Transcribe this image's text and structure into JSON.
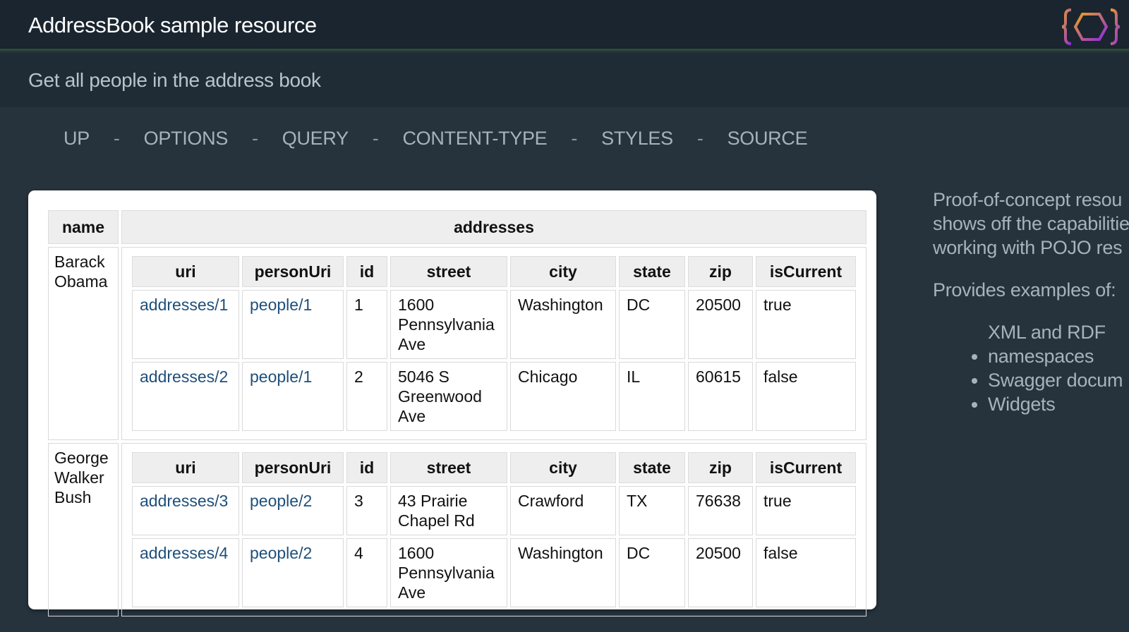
{
  "header": {
    "title": "AddressBook sample resource"
  },
  "subheader": {
    "text": "Get all people in the address book"
  },
  "nav": {
    "items": [
      "UP",
      "OPTIONS",
      "QUERY",
      "CONTENT-TYPE",
      "STYLES",
      "SOURCE"
    ],
    "separator": "-"
  },
  "table": {
    "headers": {
      "name": "name",
      "addresses": "addresses"
    },
    "inner_headers": [
      "uri",
      "personUri",
      "id",
      "street",
      "city",
      "state",
      "zip",
      "isCurrent"
    ],
    "people": [
      {
        "name": "Barack Obama",
        "addresses": [
          {
            "uri": "addresses/1",
            "personUri": "people/1",
            "id": "1",
            "street": "1600 Pennsylvania Ave",
            "city": "Washington",
            "state": "DC",
            "zip": "20500",
            "isCurrent": "true"
          },
          {
            "uri": "addresses/2",
            "personUri": "people/1",
            "id": "2",
            "street": "5046 S Greenwood Ave",
            "city": "Chicago",
            "state": "IL",
            "zip": "60615",
            "isCurrent": "false"
          }
        ]
      },
      {
        "name": "George Walker Bush",
        "addresses": [
          {
            "uri": "addresses/3",
            "personUri": "people/2",
            "id": "3",
            "street": "43 Prairie Chapel Rd",
            "city": "Crawford",
            "state": "TX",
            "zip": "76638",
            "isCurrent": "true"
          },
          {
            "uri": "addresses/4",
            "personUri": "people/2",
            "id": "4",
            "street": "1600 Pennsylvania Ave",
            "city": "Washington",
            "state": "DC",
            "zip": "20500",
            "isCurrent": "false"
          }
        ]
      }
    ]
  },
  "sidebar": {
    "description": [
      "Proof-of-concept resou",
      "shows off the capabilitie",
      "working with POJO res"
    ],
    "examples_heading": "Provides examples of:",
    "examples": [
      "XML and RDF namespaces",
      "Swagger docum",
      "Widgets"
    ]
  },
  "colors": {
    "background": "#26333d",
    "header": "#1a252f",
    "link": "#1f4f7a"
  }
}
